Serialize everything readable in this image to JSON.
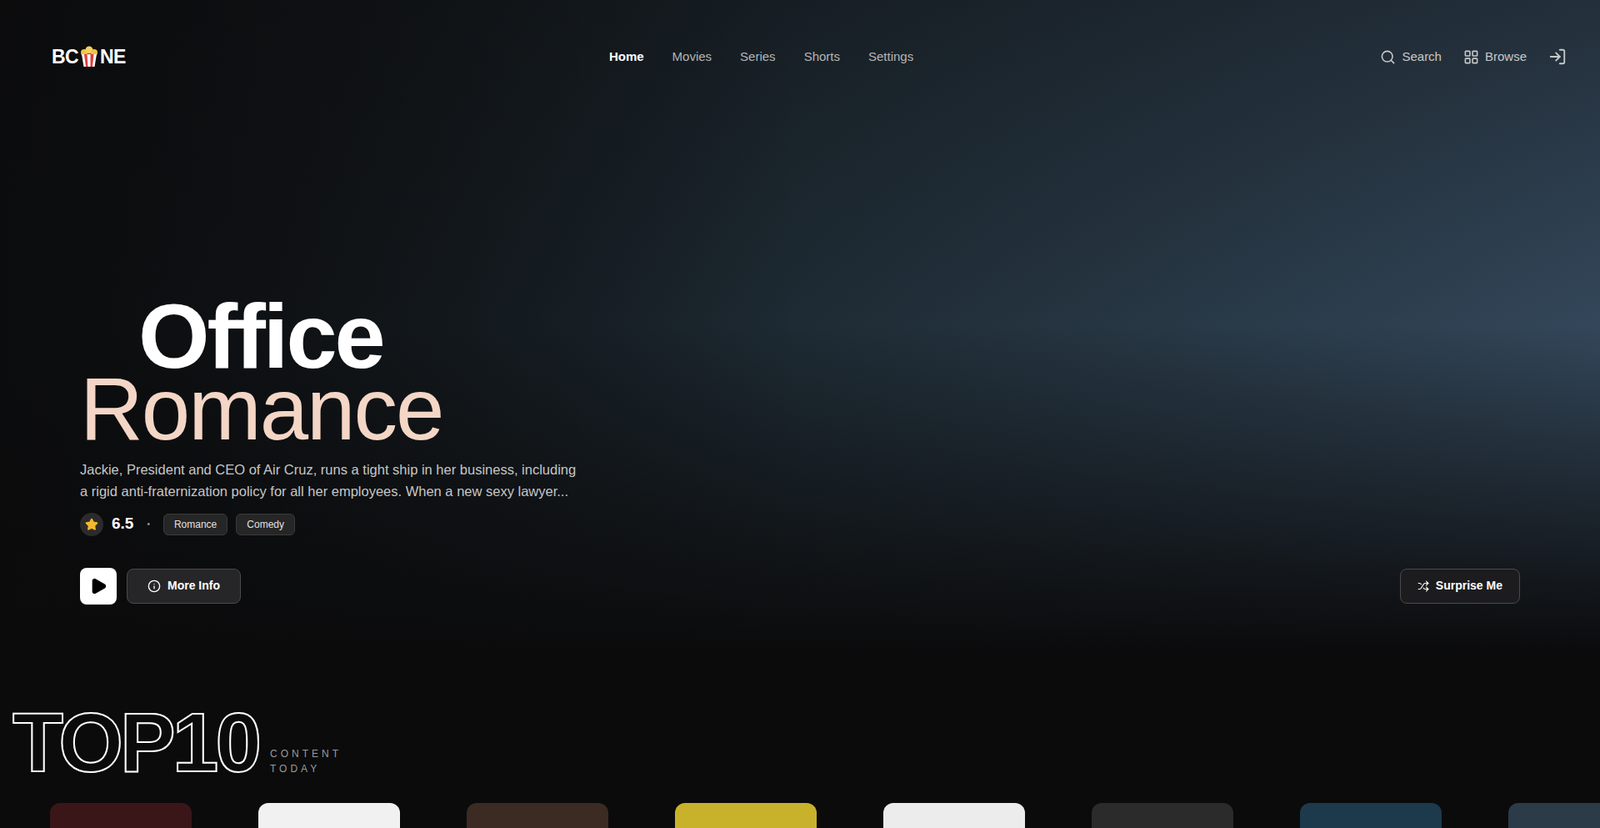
{
  "logo": {
    "left": "BC",
    "right": "NE"
  },
  "nav": [
    {
      "label": "Home",
      "selected": true
    },
    {
      "label": "Movies",
      "selected": false
    },
    {
      "label": "Series",
      "selected": false
    },
    {
      "label": "Shorts",
      "selected": false
    },
    {
      "label": "Settings",
      "selected": false
    }
  ],
  "actions": [
    {
      "label": "Search"
    },
    {
      "label": "Browse"
    }
  ],
  "hero": {
    "title_line1": "Office",
    "title_line2": "Romance",
    "description": "Jackie, President and CEO of Air Cruz, runs a tight ship in her business, including a rigid anti-fraternization policy for all her employees. When a new sexy lawyer...",
    "rating": "6.5",
    "separator": "•",
    "genres": [
      "Romance",
      "Comedy"
    ],
    "more_info": "More Info",
    "surprise": "Surprise Me"
  },
  "top10": {
    "title": "TOP10",
    "subtitle_lines": [
      "CONTENT",
      "TODAY"
    ],
    "items": [
      {
        "color": "#3a1619"
      },
      {
        "color": "#f1f1f1"
      },
      {
        "color": "#3b2b22"
      },
      {
        "color": "#c8b22c"
      },
      {
        "color": "#ececec"
      },
      {
        "color": "#2b2b2b"
      },
      {
        "color": "#1c3a4c"
      },
      {
        "color": "#2b3b47"
      }
    ]
  }
}
